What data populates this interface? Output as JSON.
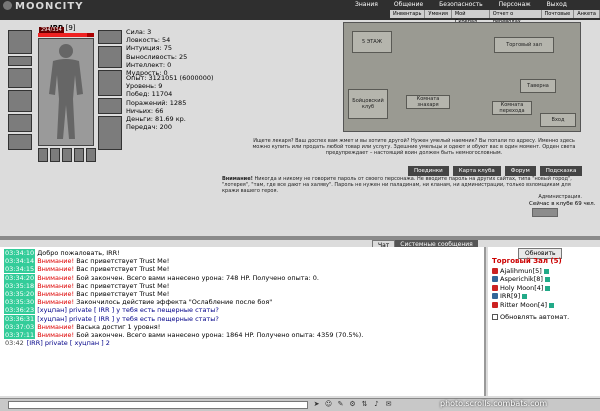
{
  "header": {
    "logo": "MOONCITY",
    "menu": [
      "Знания",
      "Общение",
      "Безопасность",
      "Персонаж",
      "Выход"
    ],
    "submenu": [
      "Инвентарь",
      "Умения",
      "Мой Скрепал",
      "Отчет о переводах",
      "Почтовые",
      "Анкета"
    ]
  },
  "character": {
    "name": "IRR",
    "level": "[9]",
    "hp": "294/334",
    "hp_fraction": 0.88,
    "stats": [
      "Сила: 3",
      "Ловкость: 54",
      "Интуиция: 75",
      "Выносливость: 25",
      "Интеллект: 0",
      "Мудрость: 0"
    ],
    "info": [
      "Опыт: 3121051 (6000000)",
      "Уровень: 9",
      "Побед: 11704",
      "Поражений: 1285",
      "Ничьих: 66",
      "Деньги: 81.69 кр.",
      "Передач: 200"
    ]
  },
  "map": {
    "rooms": [
      "5 ЭТАЖ",
      "Торговый зал",
      "Бойцовский клуб",
      "Комната знахаря",
      "Комната перехода",
      "Таверна",
      "Вход"
    ],
    "notice": "Ищете лекаря? Ваш доспех вам жмет и вы хотите другой? Нужен умелый наемник? Вы попали по адресу. Именно здесь можно купить или продать любой товар или услугу. Здешние умельцы и одеют и обуют вас в один момент. Орден света предупреждает – настоящий воин должен быть немногословным.",
    "buttons": [
      "Поединки",
      "Карта клуба",
      "Форум",
      "Подсказка"
    ]
  },
  "warning": {
    "label": "Внимание!",
    "text": "Никогда и никому не говорите пароль от своего персонажа. Не вводите пароль на других сайтах, типа \"новый город\", \"лотерея\", \"там, где все дают на халяву\". Пароль не нужен ни паладинам, ни кланам, ни администрации, только взломщикам для кражи вашего героя.",
    "sign": "Администрация.",
    "online": "Сейчас в клубе 69 чел."
  },
  "tabs": [
    "Чат",
    "Системные сообщения"
  ],
  "chat": [
    {
      "time": "03:34:10",
      "text": "Добро пожаловать, IRR!"
    },
    {
      "time": "03:34:14",
      "warn": "Внимание!",
      "text": "Вас приветствует Trust Me!"
    },
    {
      "time": "03:34:15",
      "warn": "Внимание!",
      "text": "Вас приветствует Trust Me!"
    },
    {
      "time": "03:34:20",
      "warn": "Внимание!",
      "text": "Бой закончен. Всего вами нанесено урона: 748 HP. Получено опыта: 0."
    },
    {
      "time": "03:35:18",
      "warn": "Внимание!",
      "text": "Вас приветствует Trust Me!"
    },
    {
      "time": "03:35:20",
      "warn": "Внимание!",
      "text": "Вас приветствует Trust Me!"
    },
    {
      "time": "03:35:30",
      "warn": "Внимание!",
      "text": "Закончилось действие эффекта \"Ослабление после боя\""
    },
    {
      "time": "03:36:23",
      "text": "[хуцпан] private [ IRR ] у тебя есть пещерные статы?"
    },
    {
      "time": "03:36:31",
      "text": "[хуцпан] private [ IRR ] у тебя есть пещерные статы?"
    },
    {
      "time": "03:37:03",
      "warn": "Внимание!",
      "text": "Васька достиг 1 уровня!"
    },
    {
      "time": "03:37:11",
      "warn": "Внимание!",
      "text": "Бой закончен. Всего вами нанесено урона: 1864 HP. Получено опыта: 4359 (70.5%)."
    },
    {
      "time": "03:42",
      "text": "[IRR] private [ хуцпан ] 2"
    }
  ],
  "right": {
    "refresh": "Обновить",
    "room_title": "Торговый Зал (5)",
    "users": [
      {
        "name": "Ajalihmun",
        "level": "[5]"
      },
      {
        "name": "Asperichik",
        "level": "[8]"
      },
      {
        "name": "Holy Moon",
        "level": "[4]"
      },
      {
        "name": "IRR",
        "level": "[9]"
      },
      {
        "name": "Ritter Moon",
        "level": "[4]"
      }
    ],
    "auto": "Обновлять автомат."
  },
  "watermark": "photo.scrolls.combats.com"
}
